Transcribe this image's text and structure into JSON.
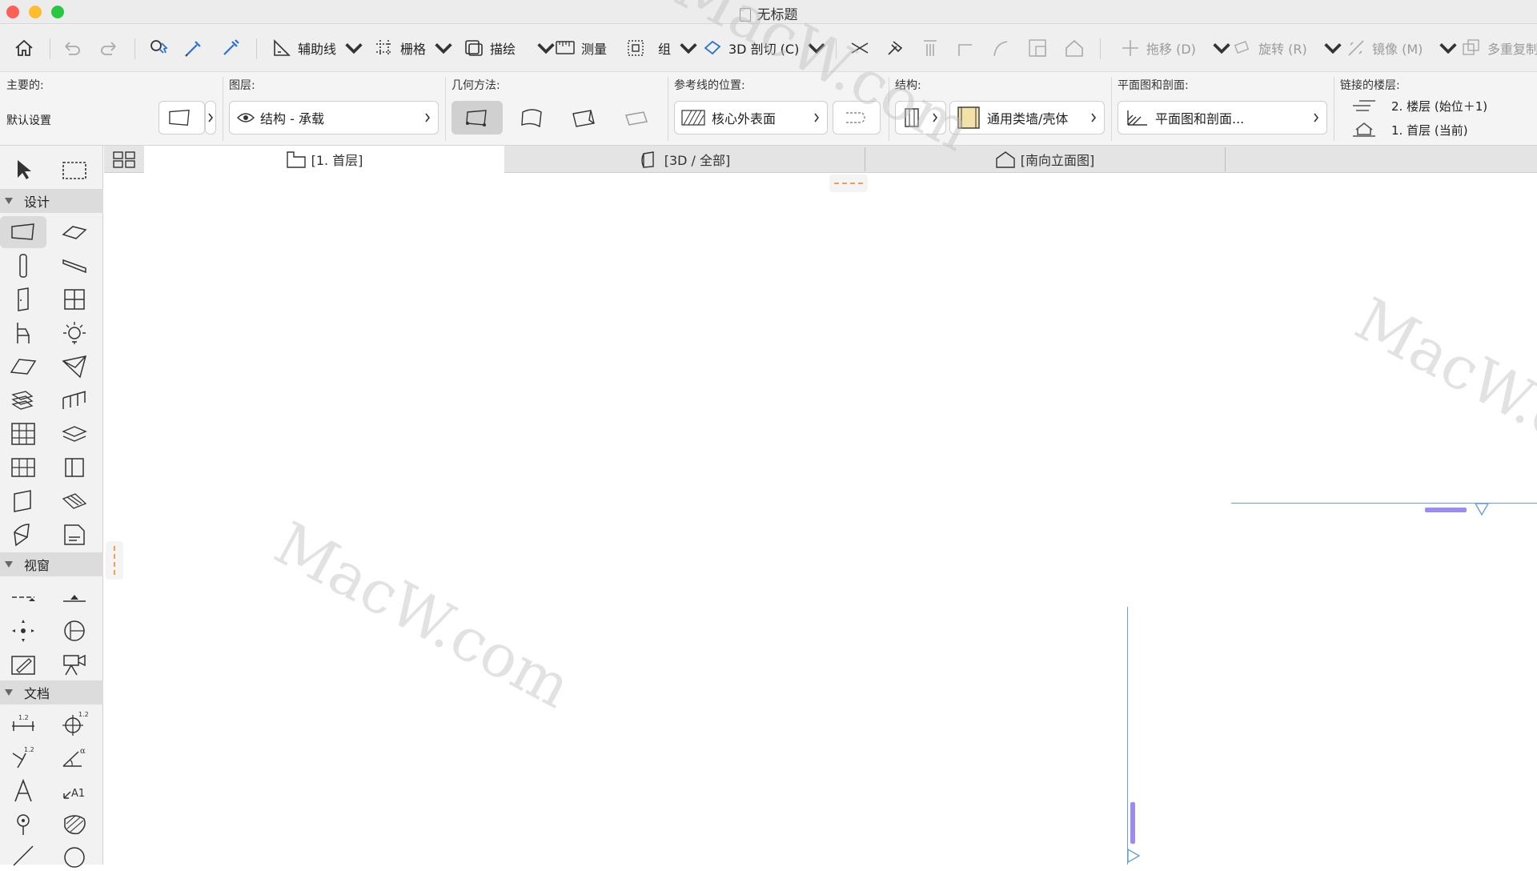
{
  "window": {
    "title": "无标题"
  },
  "toolbar": {
    "guide_label": "辅助线",
    "grid_label": "栅格",
    "trace_label": "描绘",
    "measure_label": "测量",
    "group_label": "组",
    "cut3d_label": "3D 剖切 (C)",
    "drag_label": "拖移 (D)",
    "rotate_label": "旋转 (R)",
    "mirror_label": "镜像 (M)",
    "multiply_label": "多重复制"
  },
  "infobox": {
    "main_label": "主要的:",
    "default_settings": "默认设置",
    "layer_label": "图层:",
    "layer_value": "结构 - 承载",
    "geometry_label": "几何方法:",
    "ref_line_label": "参考线的位置:",
    "ref_line_value": "核心外表面",
    "structure_label": "结构:",
    "structure_value": "通用类墙/壳体",
    "plan_section_label": "平面图和剖面:",
    "plan_section_value": "平面图和剖面...",
    "linked_stories_label": "链接的楼层:",
    "linked_top": "2. 楼层 (始位＋1)",
    "linked_bottom": "1. 首层 (当前)"
  },
  "tabs": [
    {
      "label": "[1. 首层]"
    },
    {
      "label": "[3D / 全部]"
    },
    {
      "label": "[南向立面图]"
    }
  ],
  "toolbox": {
    "design": "设计",
    "view": "视窗",
    "document": "文档"
  },
  "watermark": "MacW.com",
  "colors": {
    "accent": "#7b61ff",
    "guide": "#6aa0d8",
    "orange": "#f0a050"
  }
}
